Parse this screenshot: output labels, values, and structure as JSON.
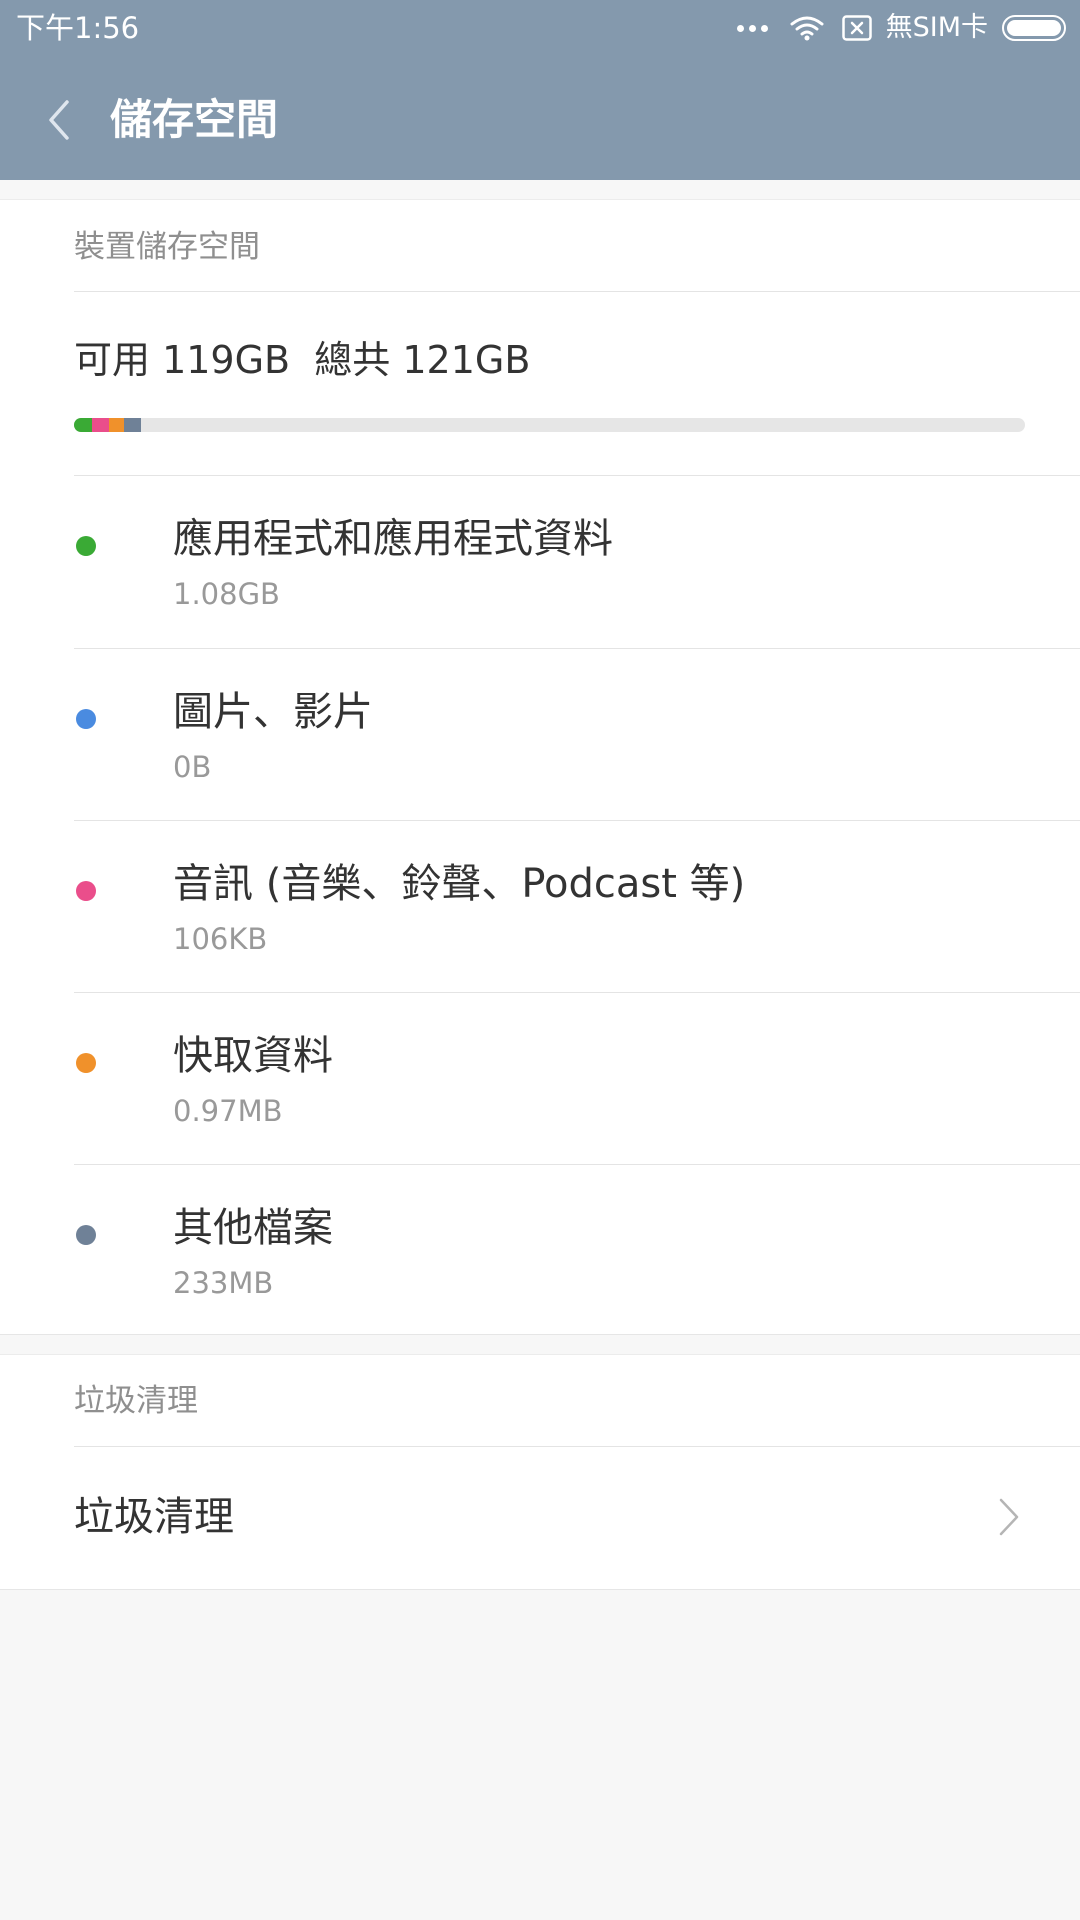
{
  "status_bar": {
    "time": "下午1:56",
    "sim_status": "無SIM卡",
    "icons": [
      "more-dots-icon",
      "wifi-icon",
      "no-sim-icon",
      "battery-icon"
    ]
  },
  "header": {
    "title": "儲存空間",
    "back_icon": "chevron-left-icon"
  },
  "device_storage": {
    "section_title": "裝置儲存空間",
    "summary": "可用 119GB  總共 121GB",
    "usage_bar": {
      "segments": [
        {
          "name": "apps",
          "color": "#3aaa35",
          "share": 0.0185
        },
        {
          "name": "audio",
          "color": "#ea4e8b",
          "share": 0.018
        },
        {
          "name": "cache",
          "color": "#f0912b",
          "share": 0.016
        },
        {
          "name": "other",
          "color": "#6f8197",
          "share": 0.018
        }
      ]
    },
    "categories": [
      {
        "label": "應用程式和應用程式資料",
        "size": "1.08GB",
        "color": "#3aaa35"
      },
      {
        "label": "圖片、影片",
        "size": "0B",
        "color": "#4a8be0"
      },
      {
        "label": "音訊 (音樂、鈴聲、Podcast 等)",
        "size": "106KB",
        "color": "#ea4e8b"
      },
      {
        "label": "快取資料",
        "size": "0.97MB",
        "color": "#f0912b"
      },
      {
        "label": "其他檔案",
        "size": "233MB",
        "color": "#6f8197"
      }
    ]
  },
  "cleanup": {
    "section_title": "垃圾清理",
    "item_label": "垃圾清理",
    "chevron_icon": "chevron-right-icon"
  }
}
